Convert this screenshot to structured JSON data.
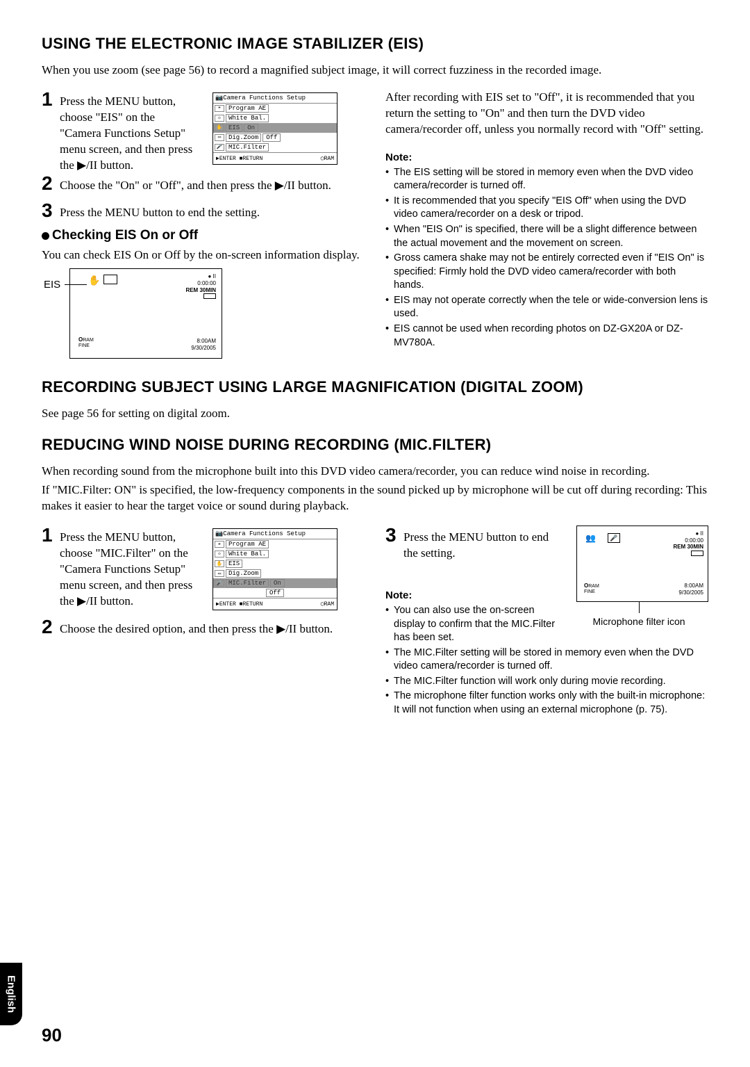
{
  "eis": {
    "title": "USING THE ELECTRONIC IMAGE STABILIZER (EIS)",
    "intro": "When you use zoom (see page 56) to record a magnified subject image, it will correct fuzziness in the recorded image.",
    "step1": "Press the MENU button, choose \"EIS\" on the \"Camera Functions Setup\" menu screen, and then press the ▶/II button.",
    "step2": "Choose the \"On\" or \"Off\", and then press the ▶/II button.",
    "step3": "Press the MENU button to end the setting.",
    "check_title": "Checking EIS On or Off",
    "check_text": "You can check EIS On or Off by the on-screen information display.",
    "eis_label": "EIS",
    "right_para": "After recording with EIS set to \"Off\", it is recommended that you return the setting to \"On\" and then turn the DVD video camera/recorder off, unless you normally record with \"Off\" setting.",
    "note_title": "Note:",
    "notes": [
      "The EIS setting will be stored in memory even when the DVD video camera/recorder is turned off.",
      "It is recommended that you specify \"EIS Off\" when using the DVD video camera/recorder on a desk or tripod.",
      "When \"EIS On\" is specified, there will be a slight difference between the actual movement and the movement on screen.",
      "Gross camera shake may not be entirely corrected even if \"EIS On\" is specified: Firmly hold the DVD video camera/recorder with both hands.",
      "EIS may not operate correctly when the tele or wide-conversion lens is used.",
      "EIS cannot be used when recording photos on DZ-GX20A or DZ-MV780A."
    ]
  },
  "digzoom": {
    "title": "RECORDING SUBJECT USING LARGE MAGNIFICATION (DIGITAL ZOOM)",
    "text": "See page 56 for setting on digital zoom."
  },
  "mic": {
    "title": "REDUCING WIND NOISE DURING RECORDING (MIC.FILTER)",
    "intro1": "When recording sound from the microphone built into this DVD video camera/recorder, you can reduce wind noise in recording.",
    "intro2": "If \"MIC.Filter: ON\" is specified, the low-frequency components in the sound picked up by microphone will be cut off during recording: This makes it easier to hear the target voice or sound during playback.",
    "step1": "Press the MENU button, choose \"MIC.Filter\" on the \"Camera Functions Setup\" menu screen, and then press the ▶/II button.",
    "step2": "Choose the desired option, and then press the ▶/II button.",
    "step3": "Press the MENU button to end the setting.",
    "caption": "Microphone filter icon",
    "note_title": "Note:",
    "notes": [
      "You can also use the on-screen display to confirm that the MIC.Filter has been set.",
      "The MIC.Filter setting will be stored in memory even when the DVD video camera/recorder is turned off.",
      "The MIC.Filter function will work only during movie recording.",
      "The microphone filter function works only with the built-in microphone: It will not function when using an external microphone (p. 75)."
    ]
  },
  "menu": {
    "title": "Camera Functions Setup",
    "items": [
      "Program AE",
      "White Bal.",
      "EIS",
      "Dig.Zoom",
      "MIC.Filter"
    ],
    "eis_val": "On",
    "dig_val": "Off",
    "mic_val": "Off",
    "footer_enter": "ENTER",
    "footer_return": "RETURN",
    "footer_ram": "RAM"
  },
  "osd": {
    "rec_pause": "● II",
    "time": "0:00:00",
    "remain": "REM 30MIN",
    "ram": "RAM",
    "fine": "FINE",
    "clock": "8:00AM",
    "date": "9/30/2005",
    "hand": "✋",
    "o": "O"
  },
  "page": {
    "side": "English",
    "num": "90"
  }
}
